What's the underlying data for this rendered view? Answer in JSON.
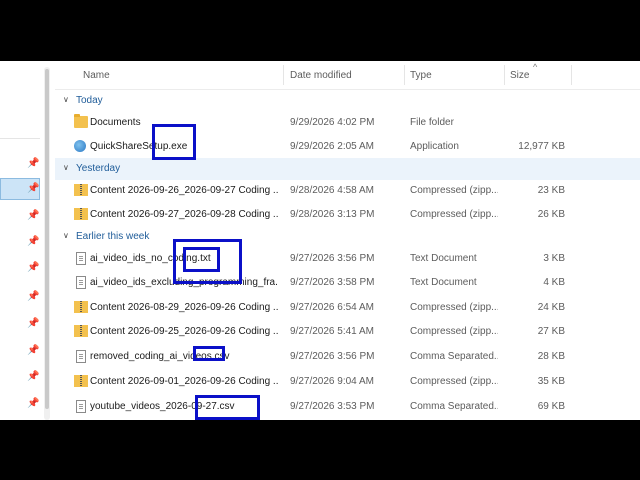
{
  "columns": {
    "name": "Name",
    "date": "Date modified",
    "type": "Type",
    "size": "Size"
  },
  "groups": [
    {
      "label": "Today",
      "rows": [
        {
          "name": "Documents",
          "date": "9/29/2026 4:02 PM",
          "type": "File folder",
          "size": "",
          "icon": "folder-icon"
        },
        {
          "name": "QuickShareSetup.exe",
          "date": "9/29/2026 2:05 AM",
          "type": "Application",
          "size": "12,977 KB",
          "icon": "app-icon"
        }
      ]
    },
    {
      "label": "Yesterday",
      "rows": [
        {
          "name": "Content 2026-09-26_2026-09-27 Coding ...",
          "date": "9/28/2026 4:58 AM",
          "type": "Compressed (zipp...",
          "size": "23 KB",
          "icon": "zip-folder-icon"
        },
        {
          "name": "Content 2026-09-27_2026-09-28 Coding ...",
          "date": "9/28/2026 3:13 PM",
          "type": "Compressed (zipp...",
          "size": "26 KB",
          "icon": "zip-folder-icon"
        }
      ]
    },
    {
      "label": "Earlier this week",
      "rows": [
        {
          "name": "ai_video_ids_no_coding.txt",
          "date": "9/27/2026 3:56 PM",
          "type": "Text Document",
          "size": "3 KB",
          "icon": "text-file-icon"
        },
        {
          "name": "ai_video_ids_excluding_programming_fra...",
          "date": "9/27/2026 3:58 PM",
          "type": "Text Document",
          "size": "4 KB",
          "icon": "text-file-icon"
        },
        {
          "name": "Content 2026-08-29_2026-09-26 Coding ...",
          "date": "9/27/2026 6:54 AM",
          "type": "Compressed (zipp...",
          "size": "24 KB",
          "icon": "zip-folder-icon"
        },
        {
          "name": "Content 2026-09-25_2026-09-26 Coding ...",
          "date": "9/27/2026 5:41 AM",
          "type": "Compressed (zipp...",
          "size": "27 KB",
          "icon": "zip-folder-icon"
        },
        {
          "name": "removed_coding_ai_videos.csv",
          "date": "9/27/2026 3:56 PM",
          "type": "Comma Separated...",
          "size": "28 KB",
          "icon": "csv-file-icon"
        },
        {
          "name": "Content 2026-09-01_2026-09-26 Coding ...",
          "date": "9/27/2026 9:04 AM",
          "type": "Compressed (zipp...",
          "size": "35 KB",
          "icon": "zip-folder-icon"
        },
        {
          "name": "youtube_videos_2026-09-27.csv",
          "date": "9/27/2026 3:53 PM",
          "type": "Comma Separated...",
          "size": "69 KB",
          "icon": "csv-file-icon"
        }
      ]
    }
  ],
  "colors": {
    "highlight_box": "#0b10c8",
    "group_header_text": "#1f5c99",
    "selected_nav": "#cce4f7"
  }
}
